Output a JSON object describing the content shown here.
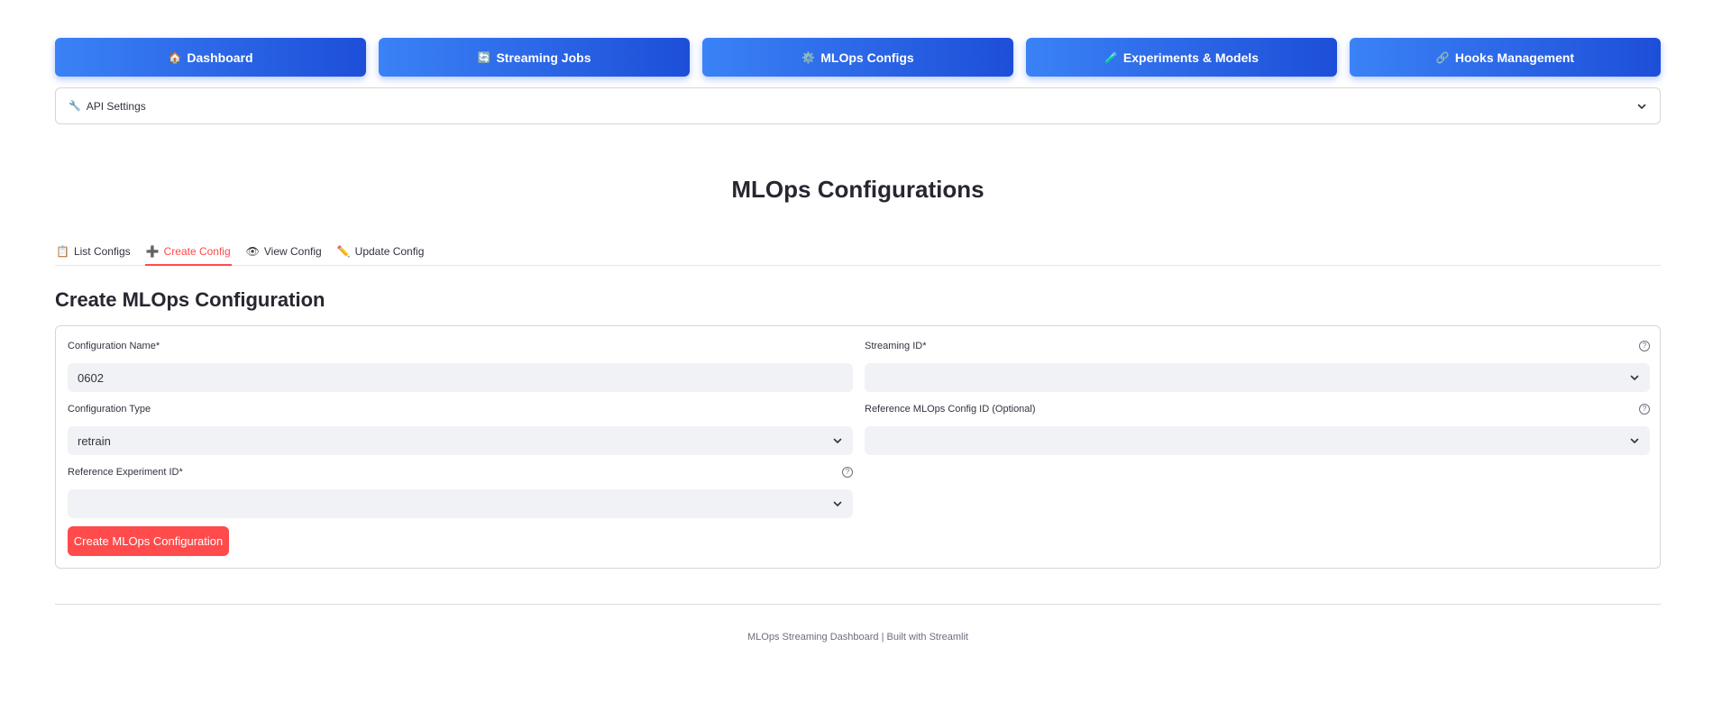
{
  "nav": [
    {
      "icon": "🏠",
      "label": "Dashboard"
    },
    {
      "icon": "🔄",
      "label": "Streaming Jobs"
    },
    {
      "icon": "⚙️",
      "label": "MLOps Configs"
    },
    {
      "icon": "🧪",
      "label": "Experiments & Models"
    },
    {
      "icon": "🔗",
      "label": "Hooks Management"
    }
  ],
  "expander": {
    "icon": "🔧",
    "label": "API Settings"
  },
  "page_title": "MLOps Configurations",
  "tabs": [
    {
      "icon": "📋",
      "label": "List Configs",
      "active": false
    },
    {
      "icon": "➕",
      "label": "Create Config",
      "active": true
    },
    {
      "icon": "👁",
      "label": "View Config",
      "active": false
    },
    {
      "icon": "✏️",
      "label": "Update Config",
      "active": false
    }
  ],
  "section_title": "Create MLOps Configuration",
  "form": {
    "config_name": {
      "label": "Configuration Name*",
      "value": "0602"
    },
    "streaming_id": {
      "label": "Streaming ID*",
      "value": ""
    },
    "config_type": {
      "label": "Configuration Type",
      "value": "retrain"
    },
    "ref_mlops": {
      "label": "Reference MLOps Config ID (Optional)",
      "value": ""
    },
    "ref_experiment": {
      "label": "Reference Experiment ID*",
      "value": ""
    },
    "help_glyph": "?",
    "submit_label": "Create MLOps Configuration"
  },
  "footer": "MLOps Streaming Dashboard | Built with Streamlit",
  "colors": {
    "primary_blue": "#2563eb",
    "accent_red": "#ff4b4b",
    "input_bg": "#f0f2f6"
  }
}
